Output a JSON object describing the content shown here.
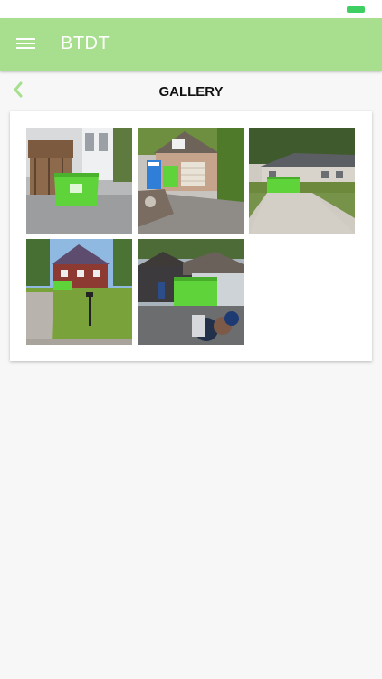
{
  "app": {
    "title": "BTDT"
  },
  "page": {
    "title": "GALLERY"
  },
  "icons": {
    "menu": "menu-icon",
    "back": "chevron-left-icon",
    "battery": "battery-icon"
  },
  "colors": {
    "app_bar": "#a8df8f",
    "accent": "#a8df8f",
    "dumpster": "#5fd43a",
    "battery": "#3ecf63",
    "background": "#f7f7f7"
  }
}
